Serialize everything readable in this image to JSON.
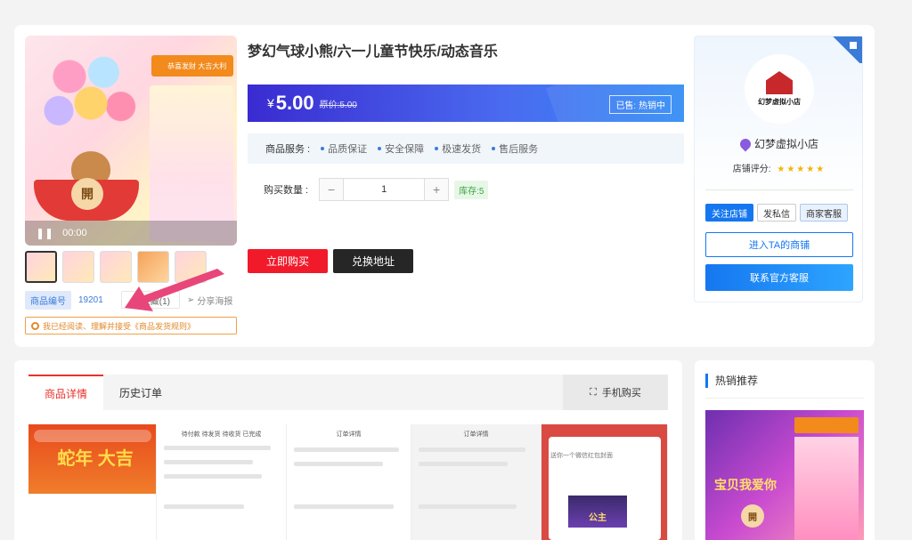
{
  "product": {
    "title": "梦幻气球小熊/六一儿童节快乐/动态音乐",
    "price_symbol": "¥",
    "price": "5.00",
    "original_price": "原价:5.00",
    "sold_badge": "已售: 热销中",
    "services_label": "商品服务 :",
    "services": [
      "品质保证",
      "安全保障",
      "极速发货",
      "售后服务"
    ],
    "qty_label": "购买数量 :",
    "qty_value": "1",
    "qty_minus": "−",
    "qty_plus": "+",
    "stock": "库存:5",
    "buy_label": "立即购买",
    "exchange_label": "兑换地址",
    "code_label": "商品编号",
    "code_value": "19201",
    "favorite_label": "收藏(1)",
    "share_label": "分享海报",
    "agree_text": "我已经阅读、理解并接受《商品发货规则》"
  },
  "gallery": {
    "open_char": "開",
    "video_time": "00:00",
    "badge_text": "恭喜发财  大吉大利"
  },
  "shop": {
    "logo_text": "幻梦虚拟小店",
    "name": "幻梦虚拟小店",
    "rating_label": "店铺评分:",
    "stars": "★★★★★",
    "follow_label": "关注店铺",
    "message_label": "发私信",
    "support_label": "商家客服",
    "enter_label": "进入TA的商铺",
    "official_service_label": "联系官方客服"
  },
  "detail": {
    "tabs": [
      {
        "label": "商品详情"
      },
      {
        "label": "历史订单"
      }
    ],
    "phone_buy": "手机购买",
    "panel1_title": "蛇年 大吉",
    "panel2_title": "待付款  待发货  待收货  已完成",
    "panel3_title": "订单详情",
    "panel4_title": "订单详情",
    "panel5_text": "送你一个微信红包封面",
    "panel5_poster": "公主"
  },
  "hot": {
    "title": "热销推荐",
    "image_text": "宝贝我爱你",
    "open_char": "開"
  },
  "colors": {
    "accent_blue": "#1577f0",
    "buy_red": "#f11a2a",
    "tab_red": "#e8322b"
  }
}
